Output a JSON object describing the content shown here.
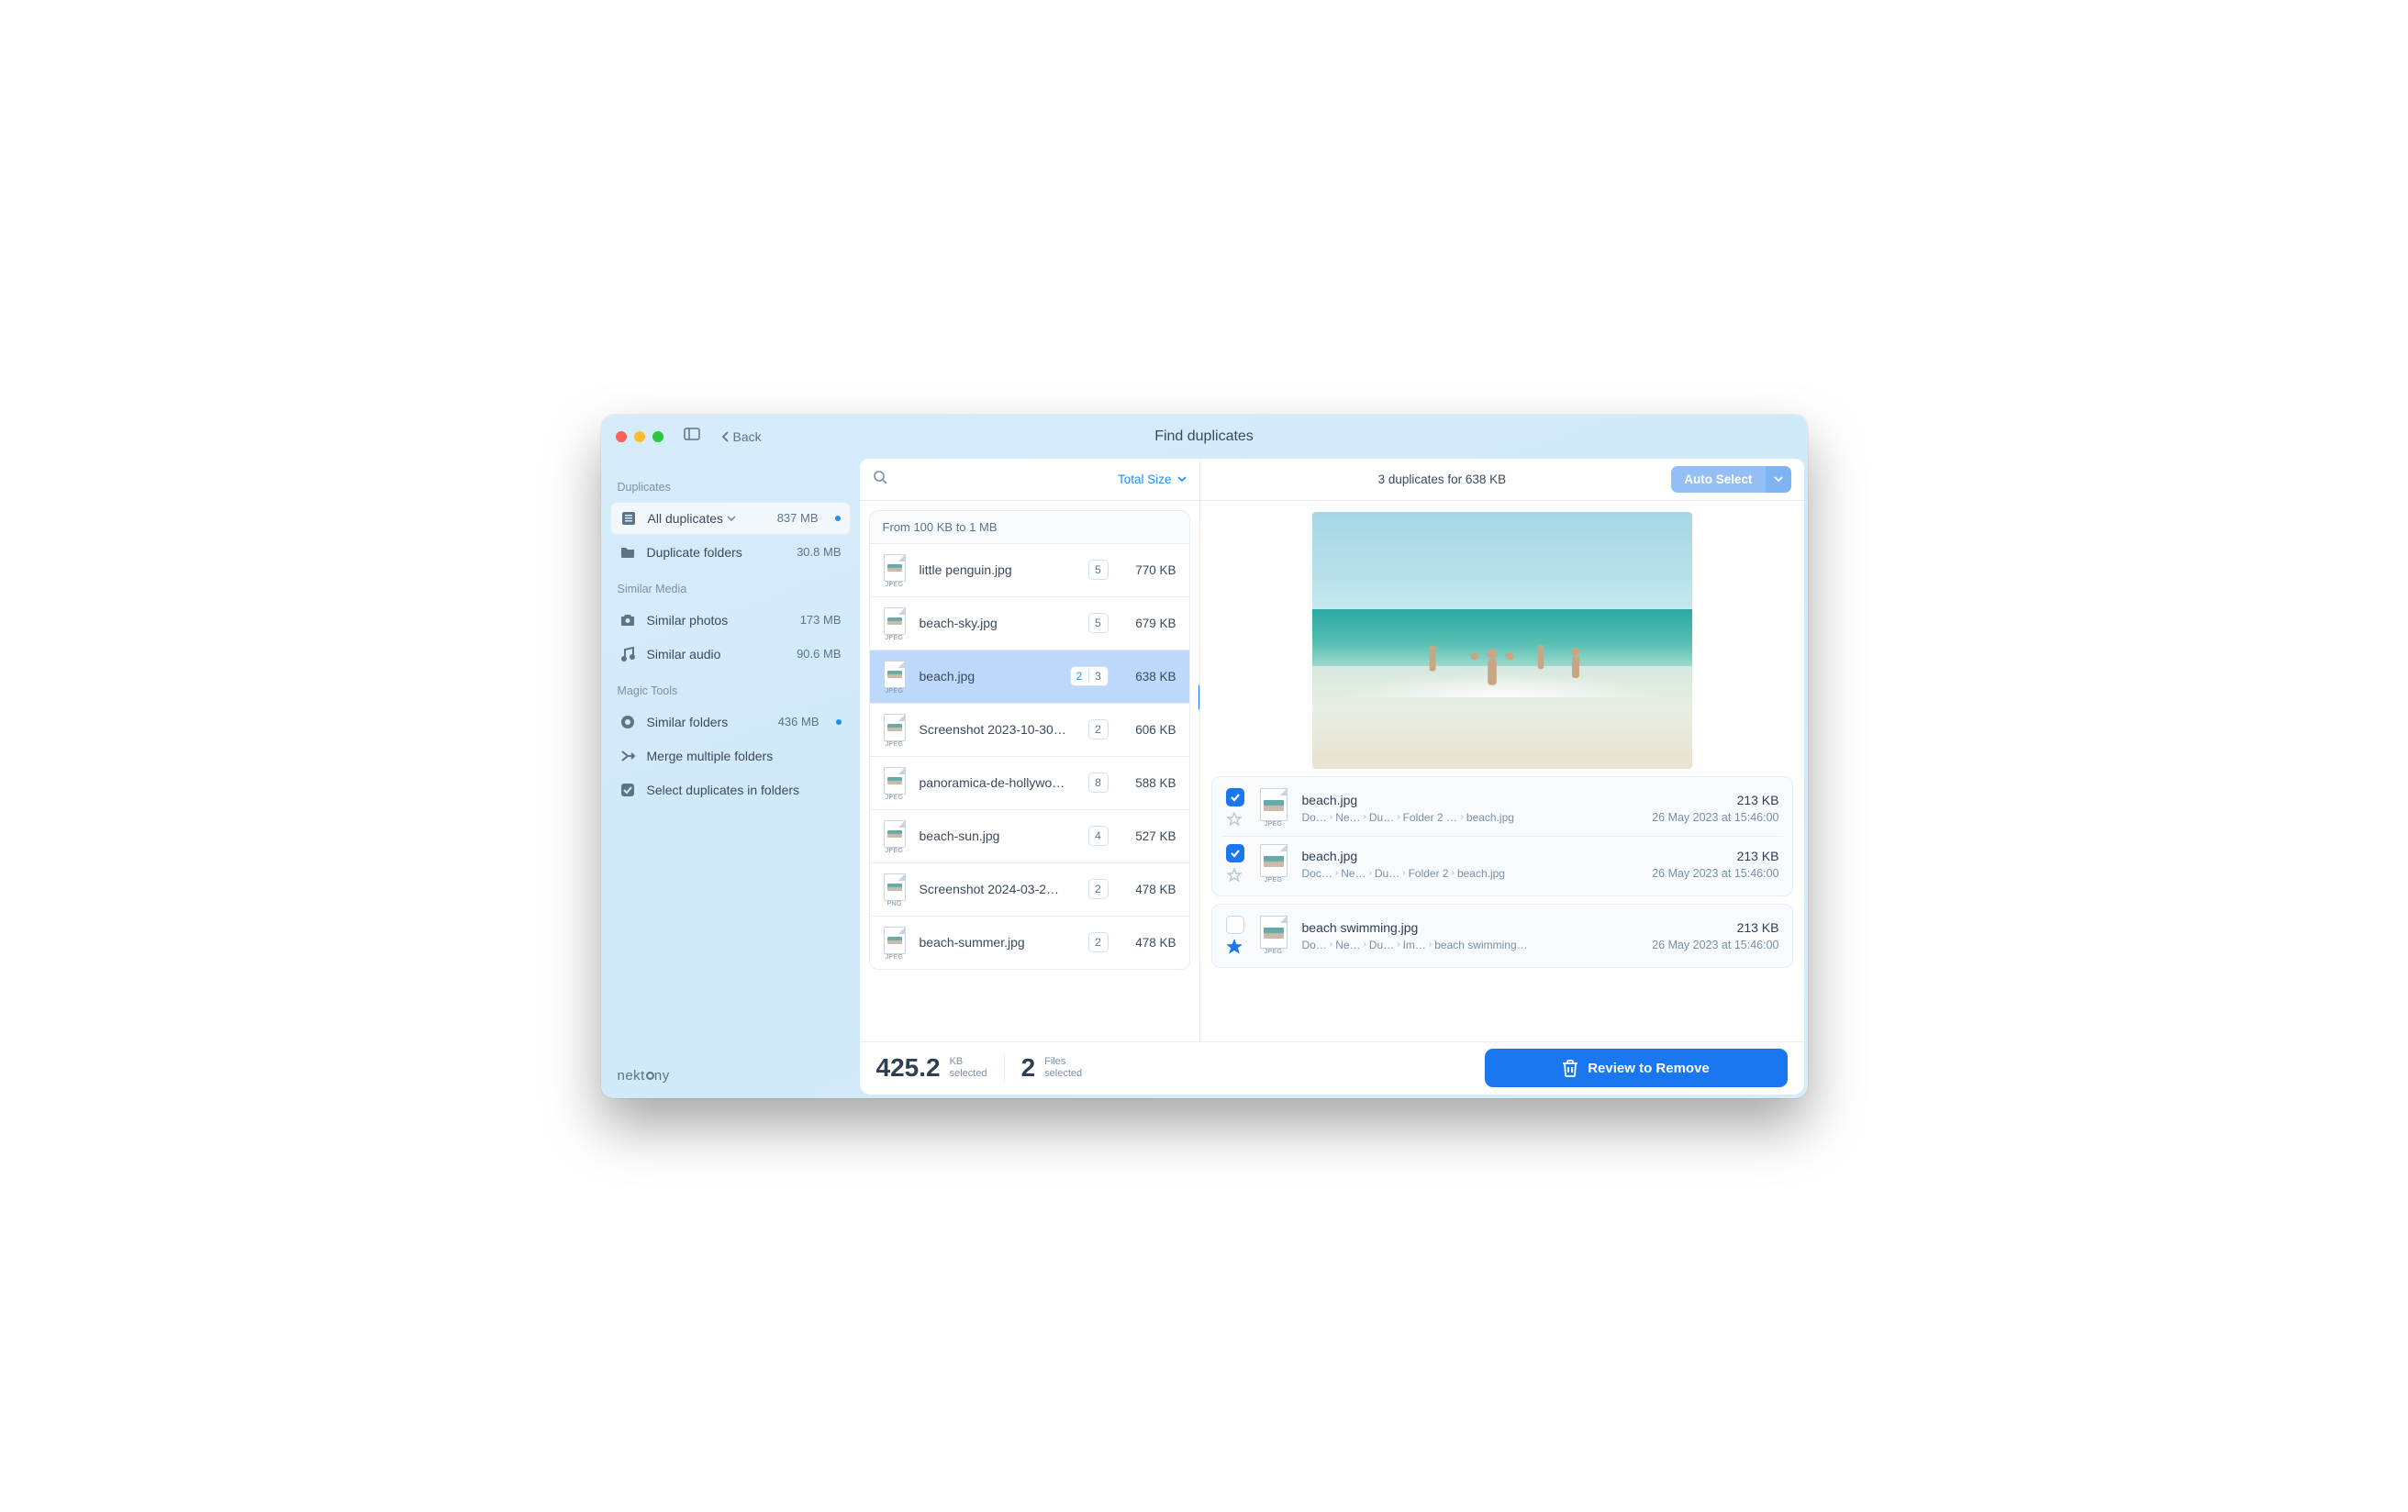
{
  "title": "Find duplicates",
  "back_label": "Back",
  "brand": "nektony",
  "sidebar": {
    "sections": [
      {
        "title": "Duplicates",
        "items": [
          {
            "label": "All duplicates",
            "value": "837 MB",
            "dot": true,
            "active": true,
            "chevron": true,
            "icon": "list"
          },
          {
            "label": "Duplicate folders",
            "value": "30.8 MB",
            "icon": "folder"
          }
        ]
      },
      {
        "title": "Similar Media",
        "items": [
          {
            "label": "Similar photos",
            "value": "173 MB",
            "icon": "camera"
          },
          {
            "label": "Similar audio",
            "value": "90.6 MB",
            "icon": "music"
          }
        ]
      },
      {
        "title": "Magic Tools",
        "items": [
          {
            "label": "Similar folders",
            "value": "436 MB",
            "dot": true,
            "icon": "folders-link"
          },
          {
            "label": "Merge multiple folders",
            "value": "",
            "icon": "merge"
          },
          {
            "label": "Select duplicates in folders",
            "value": "",
            "icon": "check-square"
          }
        ]
      }
    ]
  },
  "toolbar": {
    "sort_label": "Total Size",
    "duplicates_label": "3 duplicates for 638 KB",
    "auto_select": "Auto Select"
  },
  "group_header": "From 100 KB to 1 MB",
  "files": [
    {
      "name": "little penguin.jpg",
      "count": "5",
      "split": false,
      "size": "770 KB",
      "ext": "JPEG"
    },
    {
      "name": "beach-sky.jpg",
      "count": "5",
      "split": false,
      "size": "679 KB",
      "ext": "JPEG"
    },
    {
      "name": "beach.jpg",
      "count_a": "2",
      "count_b": "3",
      "split": true,
      "size": "638 KB",
      "ext": "JPEG",
      "selected": true
    },
    {
      "name": "Screenshot 2023-10-30…",
      "count": "2",
      "split": false,
      "size": "606 KB",
      "ext": "JPEG"
    },
    {
      "name": "panoramica-de-hollywo…",
      "count": "8",
      "split": false,
      "size": "588 KB",
      "ext": "JPEG"
    },
    {
      "name": "beach-sun.jpg",
      "count": "4",
      "split": false,
      "size": "527 KB",
      "ext": "JPEG"
    },
    {
      "name": "Screenshot 2024-03-2…",
      "count": "2",
      "split": false,
      "size": "478 KB",
      "ext": "PNG"
    },
    {
      "name": "beach-summer.jpg",
      "count": "2",
      "split": false,
      "size": "478 KB",
      "ext": "JPEG"
    }
  ],
  "duplicates": [
    {
      "checked": true,
      "starred": false,
      "name": "beach.jpg",
      "size": "213 KB",
      "date": "26 May 2023 at 15:46:00",
      "path": [
        "Do…",
        "Ne…",
        "Du…",
        "Folder 2 c…",
        "beach.jpg"
      ]
    },
    {
      "checked": true,
      "starred": false,
      "name": "beach.jpg",
      "size": "213 KB",
      "date": "26 May 2023 at 15:46:00",
      "path": [
        "Doc…",
        "Ne…",
        "Du…",
        "Folder 2",
        "beach.jpg"
      ]
    },
    {
      "checked": false,
      "starred": true,
      "name": "beach swimming.jpg",
      "size": "213 KB",
      "date": "26 May 2023 at 15:46:00",
      "path": [
        "Do…",
        "Ne…",
        "Du…",
        "Im…",
        "beach swimming…"
      ]
    }
  ],
  "footer": {
    "size_value": "425.2",
    "size_unit": "KB",
    "size_label": "selected",
    "count_value": "2",
    "count_unit": "Files",
    "count_label": "selected",
    "review_button": "Review to Remove"
  }
}
